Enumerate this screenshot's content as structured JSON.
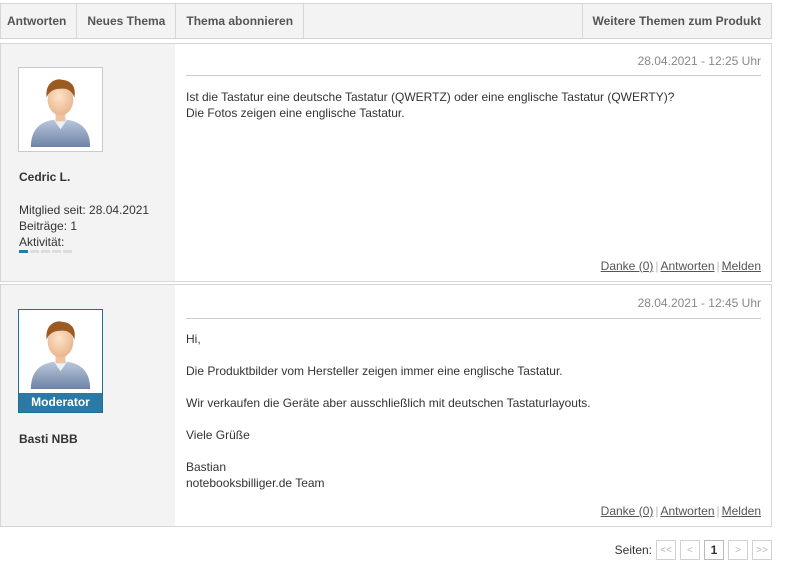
{
  "toolbar": {
    "reply": "Antworten",
    "new_topic": "Neues Thema",
    "subscribe": "Thema abonnieren",
    "more_topics": "Weitere Themen zum Produkt"
  },
  "posts": [
    {
      "date": "28.04.2021 - 12:25 Uhr",
      "user": "Cedric L.",
      "member_since": "Mitglied seit: 28.04.2021",
      "posts_count": "Beiträge: 1",
      "activity_label": "Aktivität:",
      "activity_level": 1,
      "activity_max": 5,
      "lines": [
        "Ist die Tastatur eine deutsche Tastatur (QWERTZ) oder eine englische Tastatur (QWERTY)?",
        "Die Fotos zeigen eine englische Tastatur."
      ],
      "actions": {
        "thanks": "Danke (0)",
        "reply": "Antworten",
        "report": "Melden"
      }
    },
    {
      "date": "28.04.2021 - 12:45 Uhr",
      "user": "Basti NBB",
      "badge": "Moderator",
      "paragraphs": [
        "Hi,",
        "Die Produktbilder vom Hersteller zeigen immer eine englische Tastatur.",
        "Wir verkaufen die Geräte aber ausschließlich mit deutschen Tastaturlayouts.",
        "Viele Grüße",
        "Bastian",
        "notebooksbilliger.de Team"
      ],
      "actions": {
        "thanks": "Danke (0)",
        "reply": "Antworten",
        "report": "Melden"
      }
    }
  ],
  "pager": {
    "label": "Seiten:",
    "first": "<<",
    "prev": "<",
    "current": "1",
    "next": ">",
    "last": ">>"
  },
  "icons": {
    "cursor": "hand-pointer-icon",
    "avatar": "default-avatar-icon"
  },
  "colors": {
    "accent": "#2a7aa5",
    "sidebar_bg": "#f3f3f3"
  }
}
